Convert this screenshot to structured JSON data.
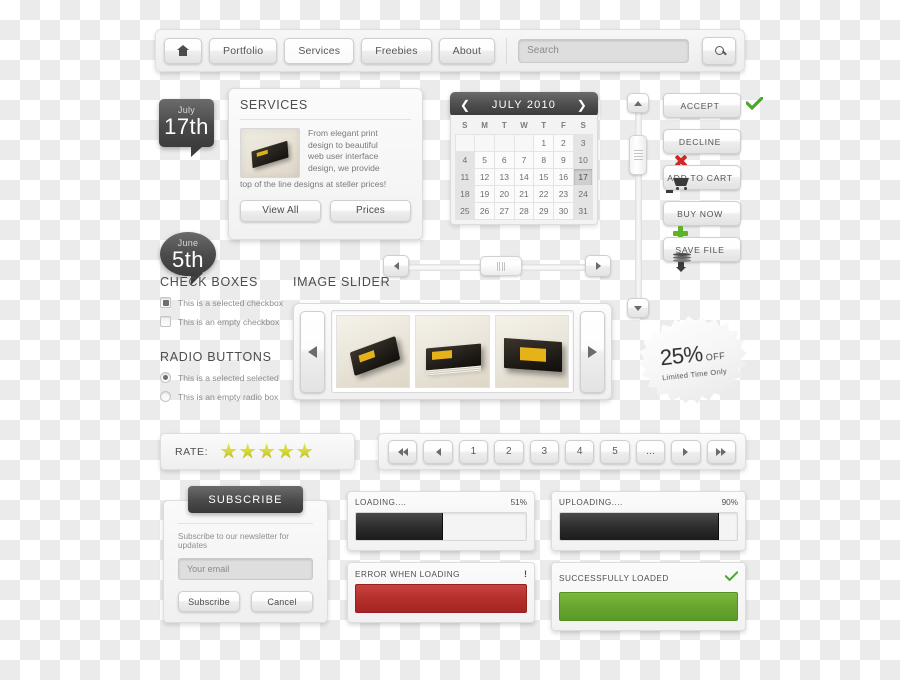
{
  "nav": {
    "home_icon": "home-icon",
    "items": [
      {
        "label": "Portfolio",
        "active": false
      },
      {
        "label": "Services",
        "active": true
      },
      {
        "label": "Freebies",
        "active": false
      },
      {
        "label": "About",
        "active": false
      }
    ],
    "search_placeholder": "Search",
    "search_icon": "magnifier-icon"
  },
  "badges": [
    {
      "month": "July",
      "day": "17th"
    },
    {
      "month": "June",
      "day": "5th"
    }
  ],
  "services": {
    "title": "SERVICES",
    "text_lines": [
      "From elegant print",
      "design to beautiful",
      "web user interface",
      "design, we provide"
    ],
    "text_tail": "top of the line designs at steller prices!",
    "buttons": [
      "View All",
      "Prices"
    ]
  },
  "calendar": {
    "title": "JULY 2010",
    "prev_icon": "arrow-left-icon",
    "next_icon": "arrow-right-icon",
    "dow": [
      "S",
      "M",
      "T",
      "W",
      "T",
      "F",
      "S"
    ],
    "weeks": [
      [
        "",
        "",
        "",
        "",
        "1",
        "2",
        "3"
      ],
      [
        "4",
        "5",
        "6",
        "7",
        "8",
        "9",
        "10"
      ],
      [
        "11",
        "12",
        "13",
        "14",
        "15",
        "16",
        "17"
      ],
      [
        "18",
        "19",
        "20",
        "21",
        "22",
        "23",
        "24"
      ],
      [
        "25",
        "26",
        "27",
        "28",
        "29",
        "30",
        "31"
      ]
    ],
    "selected": "17"
  },
  "actions": [
    {
      "label": "ACCEPT",
      "icon": "check-icon",
      "color": "#4aa82a"
    },
    {
      "label": "DECLINE",
      "icon": "x-icon",
      "color": "#cf2a25"
    },
    {
      "label": "ADD TO CART",
      "icon": "cart-icon",
      "color": "#3a3a3a"
    },
    {
      "label": "BUY NOW",
      "icon": "plus-icon",
      "color": "#5cb327"
    },
    {
      "label": "SAVE FILE",
      "icon": "download-icon",
      "color": "#3a3a3a"
    }
  ],
  "scrollbars": {
    "vertical": {
      "up_icon": "arrow-up-icon",
      "down_icon": "arrow-down-icon",
      "grip_icon": "grip-icon"
    },
    "horizontal": {
      "left_icon": "arrow-left-icon",
      "right_icon": "arrow-right-icon",
      "grip_icon": "grip-icon"
    }
  },
  "checkboxes": {
    "heading": "CHECK BOXES",
    "items": [
      {
        "label": "This is a selected checkbox",
        "checked": true
      },
      {
        "label": "This is an empty checkbox",
        "checked": false
      }
    ]
  },
  "radios": {
    "heading": "RADIO BUTTONS",
    "items": [
      {
        "label": "This is a selected selected",
        "checked": true
      },
      {
        "label": "This is an empty radio box",
        "checked": false
      }
    ]
  },
  "slider": {
    "heading": "IMAGE SLIDER",
    "prev_icon": "arrow-left-icon",
    "next_icon": "arrow-right-icon",
    "slides": [
      "business-card-fan",
      "business-card-stack",
      "business-card-box"
    ]
  },
  "discount": {
    "percent": "25%",
    "off": "OFF",
    "sub": "Limited Time Only"
  },
  "rate": {
    "label": "RATE:",
    "stars_total": 5,
    "stars_filled": 5,
    "star_color": "#d9d93a"
  },
  "pagination": {
    "first_icon": "double-arrow-left-icon",
    "prev_icon": "arrow-left-icon",
    "pages": [
      "1",
      "2",
      "3",
      "4",
      "5",
      "..."
    ],
    "next_icon": "arrow-right-icon",
    "last_icon": "double-arrow-right-icon"
  },
  "subscribe": {
    "header": "SUBSCRIBE",
    "caption": "Subscribe to our newsletter for updates",
    "email_placeholder": "Your email",
    "submit_label": "Subscribe",
    "cancel_label": "Cancel"
  },
  "status": {
    "loading": {
      "title": "LOADING....",
      "value": "51%",
      "percent": 51
    },
    "uploading": {
      "title": "UPLOADING....",
      "value": "90%",
      "percent": 90
    },
    "error": {
      "title": "ERROR WHEN LOADING",
      "mark": "!",
      "color": "#b52f2c"
    },
    "success": {
      "title": "SUCCESSFULLY LOADED",
      "icon": "check-icon",
      "color": "#68a62f"
    }
  }
}
